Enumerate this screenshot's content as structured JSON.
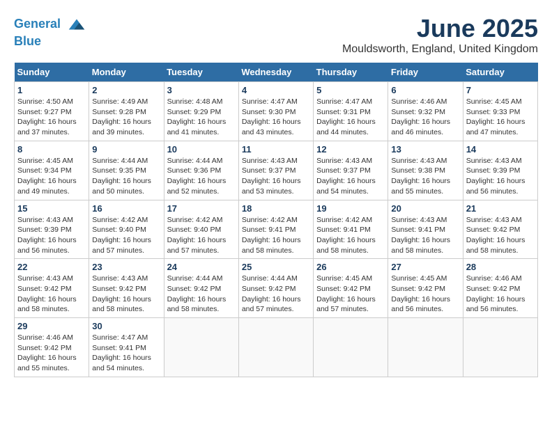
{
  "header": {
    "logo_line1": "General",
    "logo_line2": "Blue",
    "title": "June 2025",
    "location": "Mouldsworth, England, United Kingdom"
  },
  "days_of_week": [
    "Sunday",
    "Monday",
    "Tuesday",
    "Wednesday",
    "Thursday",
    "Friday",
    "Saturday"
  ],
  "weeks": [
    [
      {
        "day": 1,
        "info": "Sunrise: 4:50 AM\nSunset: 9:27 PM\nDaylight: 16 hours\nand 37 minutes."
      },
      {
        "day": 2,
        "info": "Sunrise: 4:49 AM\nSunset: 9:28 PM\nDaylight: 16 hours\nand 39 minutes."
      },
      {
        "day": 3,
        "info": "Sunrise: 4:48 AM\nSunset: 9:29 PM\nDaylight: 16 hours\nand 41 minutes."
      },
      {
        "day": 4,
        "info": "Sunrise: 4:47 AM\nSunset: 9:30 PM\nDaylight: 16 hours\nand 43 minutes."
      },
      {
        "day": 5,
        "info": "Sunrise: 4:47 AM\nSunset: 9:31 PM\nDaylight: 16 hours\nand 44 minutes."
      },
      {
        "day": 6,
        "info": "Sunrise: 4:46 AM\nSunset: 9:32 PM\nDaylight: 16 hours\nand 46 minutes."
      },
      {
        "day": 7,
        "info": "Sunrise: 4:45 AM\nSunset: 9:33 PM\nDaylight: 16 hours\nand 47 minutes."
      }
    ],
    [
      {
        "day": 8,
        "info": "Sunrise: 4:45 AM\nSunset: 9:34 PM\nDaylight: 16 hours\nand 49 minutes."
      },
      {
        "day": 9,
        "info": "Sunrise: 4:44 AM\nSunset: 9:35 PM\nDaylight: 16 hours\nand 50 minutes."
      },
      {
        "day": 10,
        "info": "Sunrise: 4:44 AM\nSunset: 9:36 PM\nDaylight: 16 hours\nand 52 minutes."
      },
      {
        "day": 11,
        "info": "Sunrise: 4:43 AM\nSunset: 9:37 PM\nDaylight: 16 hours\nand 53 minutes."
      },
      {
        "day": 12,
        "info": "Sunrise: 4:43 AM\nSunset: 9:37 PM\nDaylight: 16 hours\nand 54 minutes."
      },
      {
        "day": 13,
        "info": "Sunrise: 4:43 AM\nSunset: 9:38 PM\nDaylight: 16 hours\nand 55 minutes."
      },
      {
        "day": 14,
        "info": "Sunrise: 4:43 AM\nSunset: 9:39 PM\nDaylight: 16 hours\nand 56 minutes."
      }
    ],
    [
      {
        "day": 15,
        "info": "Sunrise: 4:43 AM\nSunset: 9:39 PM\nDaylight: 16 hours\nand 56 minutes."
      },
      {
        "day": 16,
        "info": "Sunrise: 4:42 AM\nSunset: 9:40 PM\nDaylight: 16 hours\nand 57 minutes."
      },
      {
        "day": 17,
        "info": "Sunrise: 4:42 AM\nSunset: 9:40 PM\nDaylight: 16 hours\nand 57 minutes."
      },
      {
        "day": 18,
        "info": "Sunrise: 4:42 AM\nSunset: 9:41 PM\nDaylight: 16 hours\nand 58 minutes."
      },
      {
        "day": 19,
        "info": "Sunrise: 4:42 AM\nSunset: 9:41 PM\nDaylight: 16 hours\nand 58 minutes."
      },
      {
        "day": 20,
        "info": "Sunrise: 4:43 AM\nSunset: 9:41 PM\nDaylight: 16 hours\nand 58 minutes."
      },
      {
        "day": 21,
        "info": "Sunrise: 4:43 AM\nSunset: 9:42 PM\nDaylight: 16 hours\nand 58 minutes."
      }
    ],
    [
      {
        "day": 22,
        "info": "Sunrise: 4:43 AM\nSunset: 9:42 PM\nDaylight: 16 hours\nand 58 minutes."
      },
      {
        "day": 23,
        "info": "Sunrise: 4:43 AM\nSunset: 9:42 PM\nDaylight: 16 hours\nand 58 minutes."
      },
      {
        "day": 24,
        "info": "Sunrise: 4:44 AM\nSunset: 9:42 PM\nDaylight: 16 hours\nand 58 minutes."
      },
      {
        "day": 25,
        "info": "Sunrise: 4:44 AM\nSunset: 9:42 PM\nDaylight: 16 hours\nand 57 minutes."
      },
      {
        "day": 26,
        "info": "Sunrise: 4:45 AM\nSunset: 9:42 PM\nDaylight: 16 hours\nand 57 minutes."
      },
      {
        "day": 27,
        "info": "Sunrise: 4:45 AM\nSunset: 9:42 PM\nDaylight: 16 hours\nand 56 minutes."
      },
      {
        "day": 28,
        "info": "Sunrise: 4:46 AM\nSunset: 9:42 PM\nDaylight: 16 hours\nand 56 minutes."
      }
    ],
    [
      {
        "day": 29,
        "info": "Sunrise: 4:46 AM\nSunset: 9:42 PM\nDaylight: 16 hours\nand 55 minutes."
      },
      {
        "day": 30,
        "info": "Sunrise: 4:47 AM\nSunset: 9:41 PM\nDaylight: 16 hours\nand 54 minutes."
      },
      null,
      null,
      null,
      null,
      null
    ]
  ]
}
